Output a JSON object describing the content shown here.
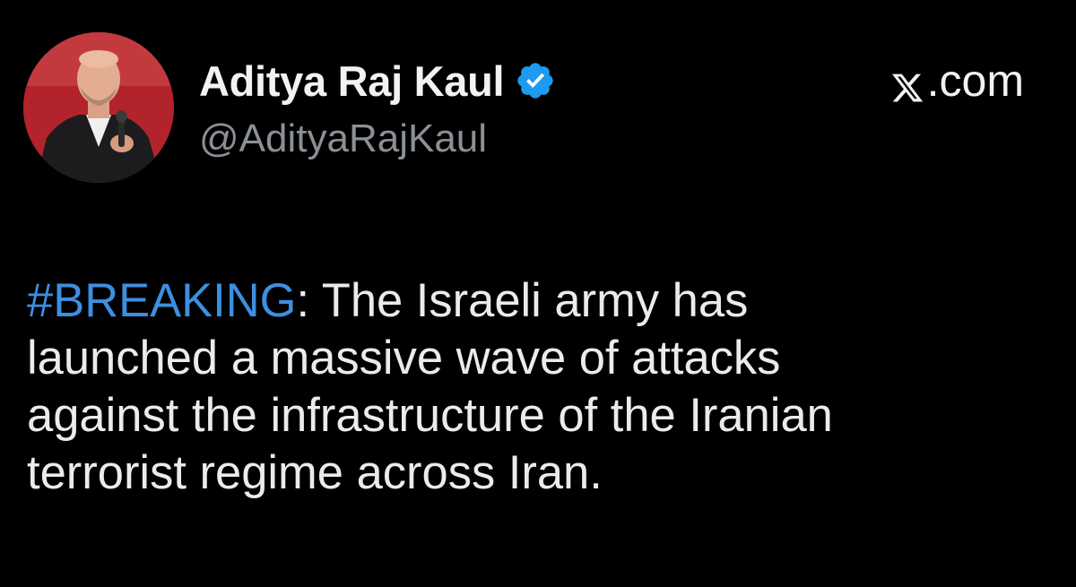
{
  "author": {
    "display_name": "Aditya Raj Kaul",
    "handle": "@AdityaRajKaul",
    "verified": true
  },
  "platform": {
    "logo_icon": "x-logo-icon",
    "label": ".com"
  },
  "tweet": {
    "hashtag": "#BREAKING",
    "line1_rest": ": The Israeli army has",
    "line2": "launched a massive wave of attacks",
    "line3": "against the infrastructure of the Iranian",
    "line4": "terrorist regime across Iran."
  },
  "colors": {
    "background": "#000000",
    "text": "#e9ebec",
    "handle": "#8b9096",
    "hashtag": "#3d8fdf",
    "verified_badge": "#1d9bf0"
  }
}
